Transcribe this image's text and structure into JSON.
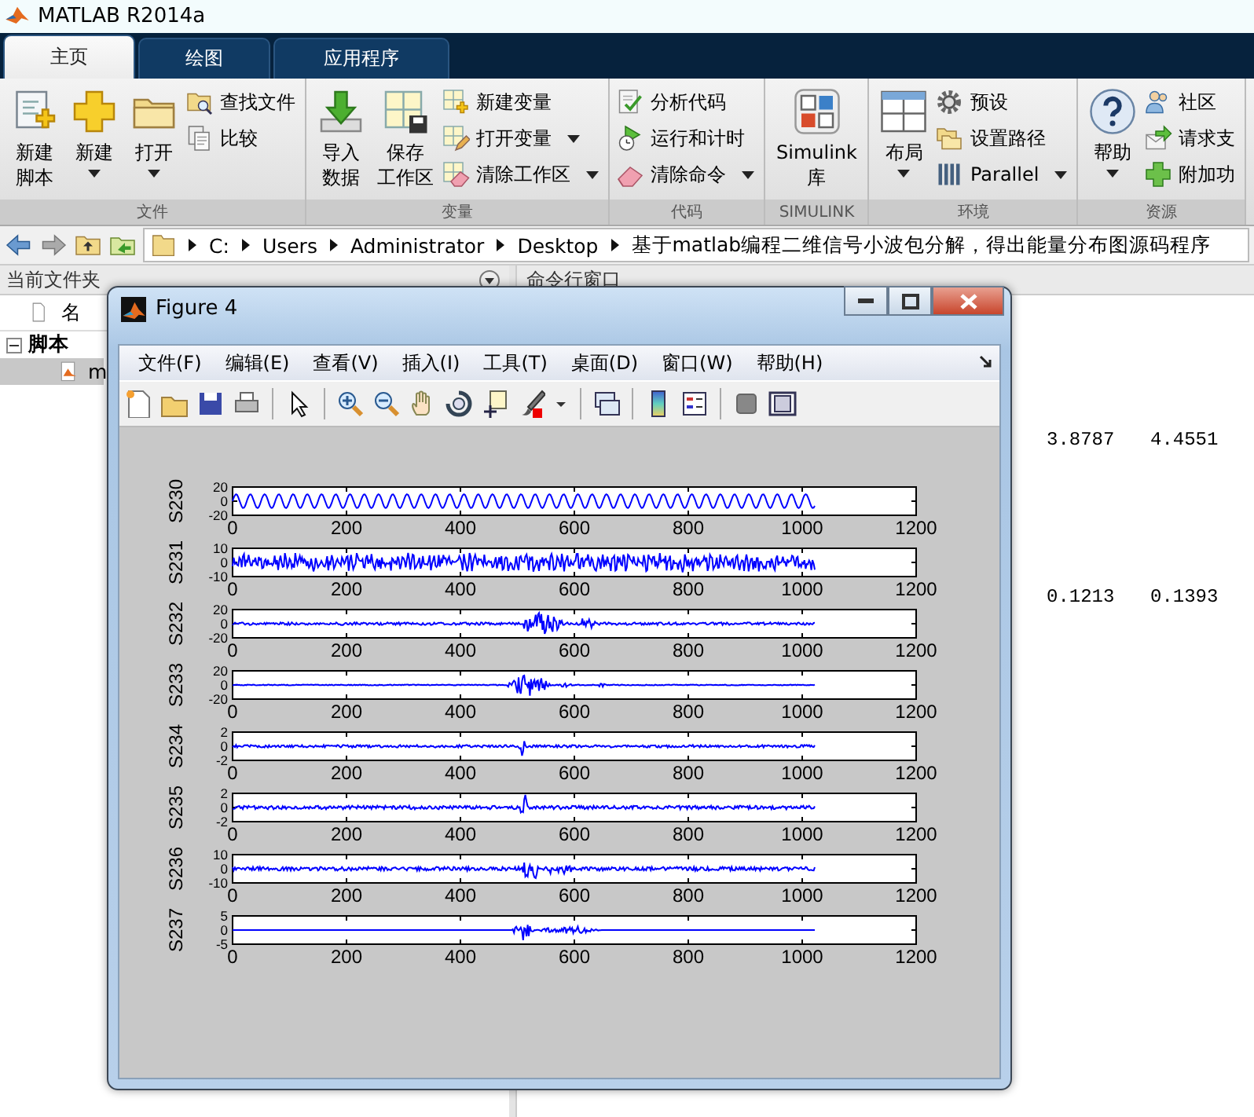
{
  "window": {
    "title": "MATLAB R2014a"
  },
  "tabs": [
    {
      "label": "主页",
      "selected": true
    },
    {
      "label": "绘图",
      "selected": false
    },
    {
      "label": "应用程序",
      "selected": false
    }
  ],
  "ribbon_groups": [
    {
      "label": "文件",
      "items": [
        {
          "kind": "large",
          "lines": [
            "新建",
            "脚本"
          ],
          "dropdown": false
        },
        {
          "kind": "large",
          "lines": [
            "新建"
          ],
          "dropdown": true
        },
        {
          "kind": "large",
          "lines": [
            "打开"
          ],
          "dropdown": true
        },
        {
          "kind": "small",
          "label": "查找文件",
          "dropdown": false
        },
        {
          "kind": "small",
          "label": "比较",
          "dropdown": false
        }
      ]
    },
    {
      "label": "变量",
      "items": [
        {
          "kind": "large",
          "lines": [
            "导入",
            "数据"
          ],
          "dropdown": false
        },
        {
          "kind": "large",
          "lines": [
            "保存",
            "工作区"
          ],
          "dropdown": false
        },
        {
          "kind": "small",
          "label": "新建变量",
          "dropdown": false
        },
        {
          "kind": "small",
          "label": "打开变量",
          "dropdown": true
        },
        {
          "kind": "small",
          "label": "清除工作区",
          "dropdown": true
        }
      ]
    },
    {
      "label": "代码",
      "items": [
        {
          "kind": "small",
          "label": "分析代码",
          "dropdown": false
        },
        {
          "kind": "small",
          "label": "运行和计时",
          "dropdown": false
        },
        {
          "kind": "small",
          "label": "清除命令",
          "dropdown": true
        }
      ]
    },
    {
      "label": "SIMULINK",
      "items": [
        {
          "kind": "large",
          "lines": [
            "Simulink",
            "库"
          ],
          "dropdown": false
        }
      ]
    },
    {
      "label": "环境",
      "items": [
        {
          "kind": "large",
          "lines": [
            "布局"
          ],
          "dropdown": true
        },
        {
          "kind": "small",
          "label": "预设",
          "dropdown": false
        },
        {
          "kind": "small",
          "label": "设置路径",
          "dropdown": false
        },
        {
          "kind": "small",
          "label": "Parallel",
          "dropdown": true
        }
      ]
    },
    {
      "label": "资源",
      "items": [
        {
          "kind": "large",
          "lines": [
            "帮助"
          ],
          "dropdown": true
        },
        {
          "kind": "small",
          "label": "社区",
          "dropdown": false
        },
        {
          "kind": "small",
          "label": "请求支",
          "dropdown": false
        },
        {
          "kind": "small",
          "label": "附加功",
          "dropdown": false
        }
      ]
    }
  ],
  "address_bar": {
    "path": [
      "C:",
      "Users",
      "Administrator",
      "Desktop",
      "基于matlab编程二维信号小波包分解，得出能量分布图源码程序"
    ]
  },
  "current_folder": {
    "title": "当前文件夹",
    "column_header": "名",
    "tree": [
      {
        "label": "脚本",
        "expanded": true,
        "children": [
          {
            "label": "m",
            "selected": true
          }
        ]
      }
    ]
  },
  "command_window": {
    "title": "命令行窗口",
    "rows": [
      [
        "3.8787",
        "4.4551"
      ],
      [
        "0.1213",
        "0.1393"
      ]
    ]
  },
  "figure": {
    "title": "Figure 4",
    "menu": [
      "文件(F)",
      "编辑(E)",
      "查看(V)",
      "插入(I)",
      "工具(T)",
      "桌面(D)",
      "窗口(W)",
      "帮助(H)"
    ],
    "plots": [
      {
        "ylabel": "S230",
        "yticks": [
          "20",
          "0",
          "-20"
        ],
        "xticks": [
          "0",
          "200",
          "400",
          "600",
          "800",
          "1000",
          "1200"
        ]
      },
      {
        "ylabel": "S231",
        "yticks": [
          "10",
          "0",
          "-10"
        ],
        "xticks": [
          "0",
          "200",
          "400",
          "600",
          "800",
          "1000",
          "1200"
        ]
      },
      {
        "ylabel": "S232",
        "yticks": [
          "20",
          "0",
          "-20"
        ],
        "xticks": [
          "0",
          "200",
          "400",
          "600",
          "800",
          "1000",
          "1200"
        ]
      },
      {
        "ylabel": "S233",
        "yticks": [
          "20",
          "0",
          "-20"
        ],
        "xticks": [
          "0",
          "200",
          "400",
          "600",
          "800",
          "1000",
          "1200"
        ]
      },
      {
        "ylabel": "S234",
        "yticks": [
          "2",
          "0",
          "-2"
        ],
        "xticks": [
          "0",
          "200",
          "400",
          "600",
          "800",
          "1000",
          "1200"
        ]
      },
      {
        "ylabel": "S235",
        "yticks": [
          "2",
          "0",
          "-2"
        ],
        "xticks": [
          "0",
          "200",
          "400",
          "600",
          "800",
          "1000",
          "1200"
        ]
      },
      {
        "ylabel": "S236",
        "yticks": [
          "10",
          "0",
          "-10"
        ],
        "xticks": [
          "0",
          "200",
          "400",
          "600",
          "800",
          "1000",
          "1200"
        ]
      },
      {
        "ylabel": "S237",
        "yticks": [
          "5",
          "0",
          "-5"
        ],
        "xticks": [
          "0",
          "200",
          "400",
          "600",
          "800",
          "1000",
          "1200"
        ]
      }
    ]
  }
}
